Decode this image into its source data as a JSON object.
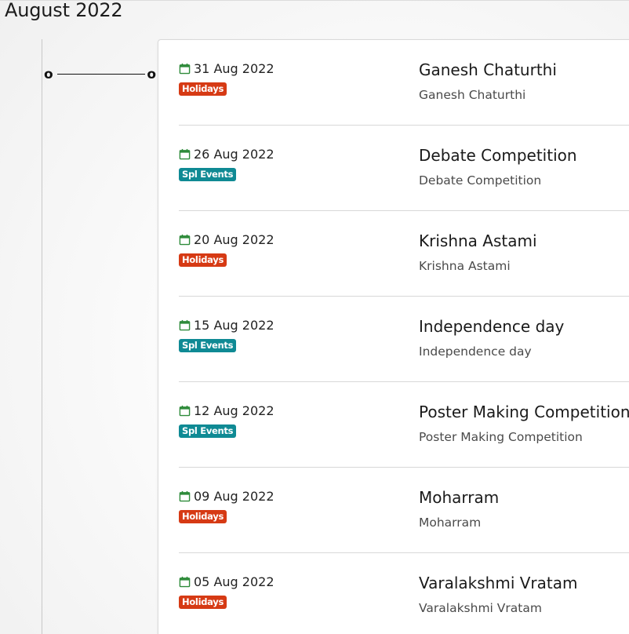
{
  "header": {
    "month_title": "August 2022"
  },
  "connector": {
    "left_marker": "o",
    "right_marker": "o"
  },
  "colors": {
    "holidays_badge": "#d63a14",
    "spl_events_badge": "#0f8a94",
    "calendar_icon": "#2e8b3a"
  },
  "events": [
    {
      "date": "31 Aug 2022",
      "category": "Holidays",
      "title": "Ganesh Chaturthi",
      "subtitle": "Ganesh Chaturthi",
      "icon": "calendar-icon"
    },
    {
      "date": "26 Aug 2022",
      "category": "Spl Events",
      "title": "Debate Competition",
      "subtitle": "Debate Competition",
      "icon": "calendar-icon"
    },
    {
      "date": "20 Aug 2022",
      "category": "Holidays",
      "title": "Krishna Astami",
      "subtitle": "Krishna Astami",
      "icon": "calendar-icon"
    },
    {
      "date": "15 Aug 2022",
      "category": "Spl Events",
      "title": "Independence day",
      "subtitle": "Independence day",
      "icon": "calendar-icon"
    },
    {
      "date": "12 Aug 2022",
      "category": "Spl Events",
      "title": "Poster Making Competition",
      "subtitle": "Poster Making Competition",
      "icon": "calendar-icon"
    },
    {
      "date": "09 Aug 2022",
      "category": "Holidays",
      "title": "Moharram",
      "subtitle": "Moharram",
      "icon": "calendar-icon"
    },
    {
      "date": "05 Aug 2022",
      "category": "Holidays",
      "title": "Varalakshmi Vratam",
      "subtitle": "Varalakshmi Vratam",
      "icon": "calendar-icon"
    }
  ]
}
